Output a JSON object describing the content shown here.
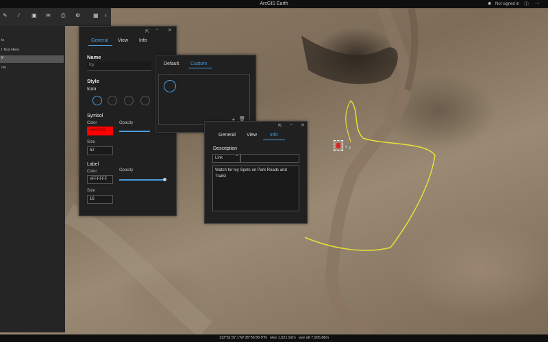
{
  "app": {
    "title": "ArcGIS Earth",
    "account": "Not signed in"
  },
  "sidebar": {
    "items": [
      {
        "label": "ts"
      },
      {
        "label": "l Text Here"
      },
      {
        "label": "y"
      },
      {
        "label": "ow"
      }
    ]
  },
  "map": {
    "placemark_label": "Icy"
  },
  "status": {
    "coords": "113°51'37.1\"W 35°56'38.0\"N   elev 1,521.92m   eye alt 7,565.88m"
  },
  "properties_panel": {
    "tabs": [
      "General",
      "View",
      "Info"
    ],
    "active_tab": "General",
    "name_label": "Name",
    "name_value": "Icy",
    "style_label": "Style",
    "icon_label": "Icon",
    "symbol_label": "Symbol",
    "color_label": "Color",
    "symbol_color": "#FF0000",
    "opacity_label": "Opacity",
    "size_label": "Size",
    "symbol_size": "52",
    "label_section": "Label",
    "label_color_label": "Color",
    "label_color": "#FFFFFF",
    "label_opacity_label": "Opacity",
    "label_size_label": "Size",
    "label_size": "16"
  },
  "icon_panel": {
    "tabs": [
      "Default",
      "Custom"
    ],
    "active_tab": "Custom"
  },
  "info_panel": {
    "tabs": [
      "General",
      "View",
      "Info"
    ],
    "active_tab": "Info",
    "description_label": "Description",
    "link_option": "Link",
    "description_text": "Watch for Icy Spots on Park Roads and Trails!"
  },
  "colors": {
    "accent": "#4a9de0",
    "symbol_red": "#FF0000",
    "trail_yellow": "#e6e03a"
  },
  "icons": [
    "pencil-icon",
    "ruler-icon",
    "image-icon",
    "mail-icon",
    "print-icon",
    "gear-icon",
    "grid-icon",
    "chevron-left-icon"
  ]
}
